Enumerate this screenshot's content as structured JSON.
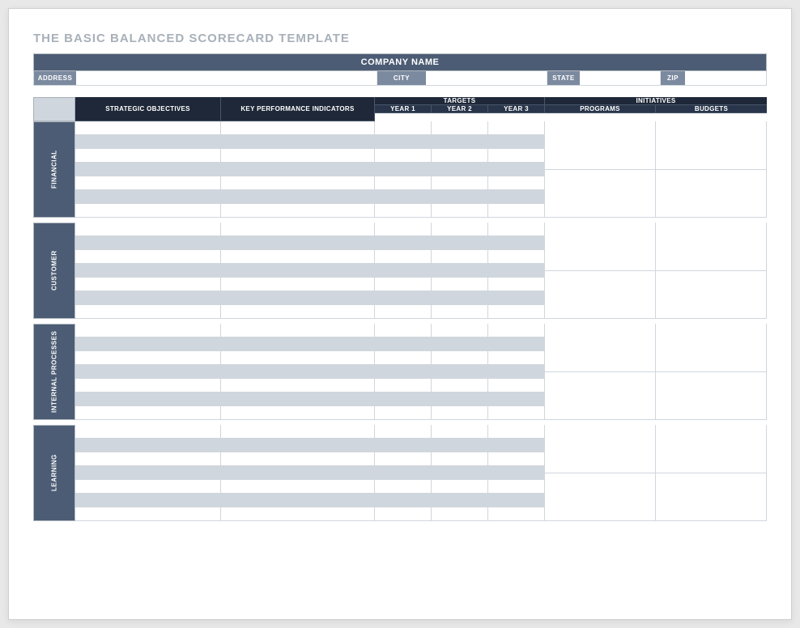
{
  "title": "THE BASIC BALANCED SCORECARD TEMPLATE",
  "company_bar": "COMPANY NAME",
  "address_labels": {
    "address": "ADDRESS",
    "city": "CITY",
    "state": "STATE",
    "zip": "ZIP"
  },
  "headers": {
    "strategic_objectives": "STRATEGIC OBJECTIVES",
    "kpi": "KEY PERFORMANCE INDICATORS",
    "targets": "TARGETS",
    "year1": "YEAR 1",
    "year2": "YEAR 2",
    "year3": "YEAR 3",
    "initiatives": "INITIATIVES",
    "programs": "PROGRAMS",
    "budgets": "BUDGETS"
  },
  "sections": {
    "financial": "FINANCIAL",
    "customer": "CUSTOMER",
    "internal_processes": "INTERNAL PROCESSES",
    "learning": "LEARNING"
  }
}
